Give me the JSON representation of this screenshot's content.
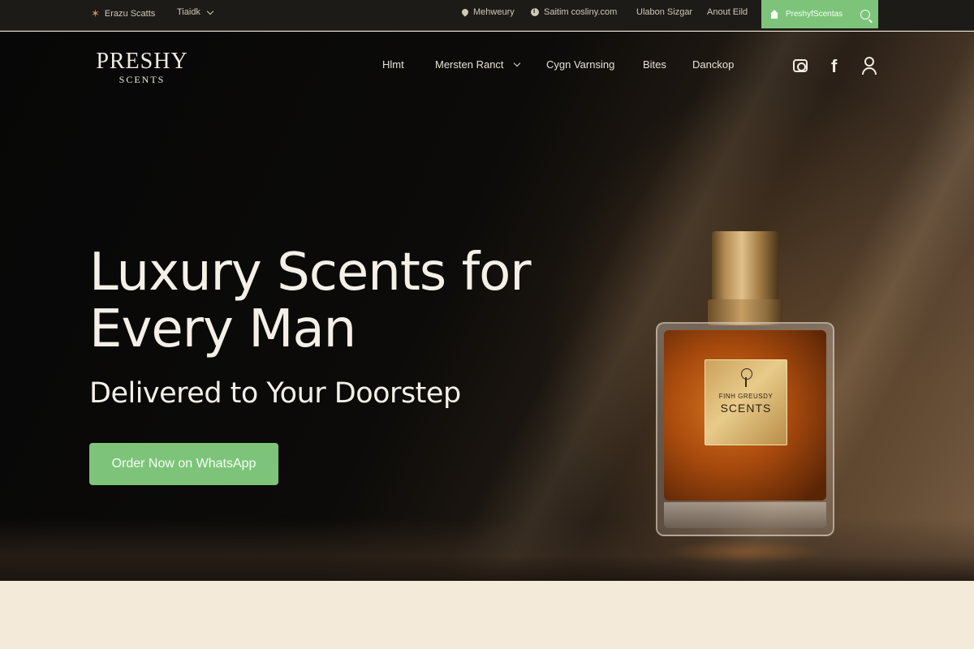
{
  "topbar": {
    "brand_text": "Erazu Scatts",
    "lang_text": "Tiaidk",
    "delivery_text": "Mehweury",
    "email_text": "Saitim cosliny.com",
    "hours_text": "Ulabon Sizgar",
    "about_text": "Anout Eild",
    "cta_text": "PreshyfScentas"
  },
  "logo": {
    "line1": "PRESHY",
    "line2": "SCENTS"
  },
  "nav": {
    "items": [
      "Hlmt",
      "Mersten Ranct",
      "Cygn Varnsing",
      "Bites",
      "Danckop"
    ]
  },
  "icons": [
    "camera-icon",
    "facebook-icon",
    "user-icon",
    "search-icon",
    "home-icon",
    "chevron-down-icon",
    "pin-icon",
    "info-icon"
  ],
  "hero": {
    "title": "Luxury Scents for Every Man",
    "subtitle": "Delivered to Your Doorstep",
    "button": "Order Now on WhatsApp"
  },
  "bottle_label": {
    "line1": "FINH GREUSDY",
    "line2": "SCENTS"
  },
  "colors": {
    "accent_green": "#7dc47a",
    "hero_dark": "#0c0b09",
    "cream": "#f3ead9"
  }
}
